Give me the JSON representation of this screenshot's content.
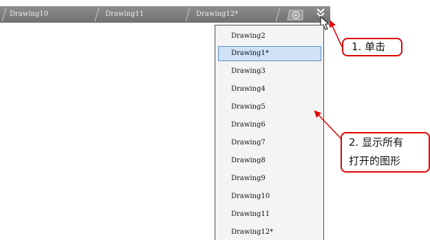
{
  "tabs": [
    {
      "label": "Drawing10"
    },
    {
      "label": "Drawing11"
    },
    {
      "label": "Drawing12*"
    }
  ],
  "menu": {
    "items": [
      {
        "label": "Drawing2"
      },
      {
        "label": "Drawing1*",
        "selected": true
      },
      {
        "label": "Drawing3"
      },
      {
        "label": "Drawing4"
      },
      {
        "label": "Drawing5"
      },
      {
        "label": "Drawing6"
      },
      {
        "label": "Drawing7"
      },
      {
        "label": "Drawing8"
      },
      {
        "label": "Drawing9"
      },
      {
        "label": "Drawing10"
      },
      {
        "label": "Drawing11"
      },
      {
        "label": "Drawing12*"
      }
    ]
  },
  "annotations": {
    "step1": "1. 单击",
    "step2_line1": "2. 显示所有",
    "step2_line2": "打开的图形"
  },
  "colors": {
    "annotation": "#e00000",
    "selection": "#cfe2f7",
    "tabstrip": "#7f7f7f"
  },
  "icons": [
    "new-tab-icon",
    "double-chevron-down-icon",
    "mouse-cursor-icon"
  ]
}
